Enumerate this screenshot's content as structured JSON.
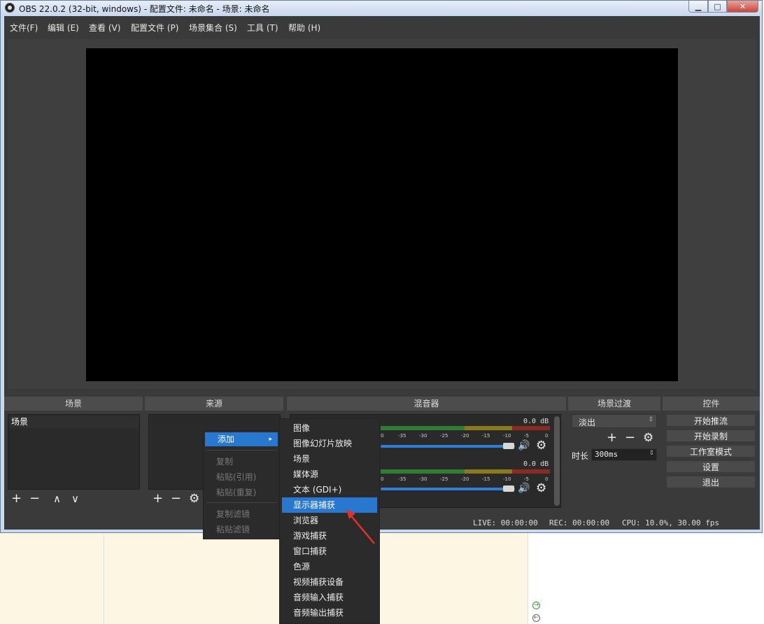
{
  "window": {
    "title": "OBS 22.0.2 (32-bit, windows) - 配置文件: 未命名 - 场景: 未命名",
    "minimize_glyph": "▁",
    "maximize_glyph": "□",
    "close_glyph": "✕"
  },
  "menubar": [
    "文件(F)",
    "编辑 (E)",
    "查看 (V)",
    "配置文件 (P)",
    "场景集合 (S)",
    "工具 (T)",
    "帮助 (H)"
  ],
  "docks": {
    "scenes": "场景",
    "sources": "来源",
    "mixer": "混音器",
    "transitions": "场景过渡",
    "controls": "控件"
  },
  "scenes": {
    "items": [
      "场景"
    ],
    "add_icon": "+",
    "remove_icon": "−",
    "up_icon": "∧",
    "down_icon": "∨"
  },
  "sources": {
    "add_icon": "+",
    "remove_icon": "−",
    "settings_icon": "⚙"
  },
  "mixer": {
    "tracks": [
      {
        "db": "0.0 dB"
      },
      {
        "db": "0.0 dB"
      }
    ],
    "ticks": [
      "0",
      "-35",
      "-30",
      "-25",
      "-20",
      "-15",
      "-10",
      "-5",
      "0"
    ],
    "speaker_icon": "🔊",
    "settings_icon": "⚙"
  },
  "transitions": {
    "selected": "淡出",
    "duration_label": "时长",
    "duration_value": "300ms",
    "add_icon": "+",
    "remove_icon": "−",
    "settings_icon": "⚙"
  },
  "controls": [
    "开始推流",
    "开始录制",
    "工作室模式",
    "设置",
    "退出"
  ],
  "status": {
    "live": "LIVE: 00:00:00",
    "rec": "REC: 00:00:00",
    "cpu": "CPU: 10.0%, 30.00 fps"
  },
  "context_menu": {
    "add": "添加",
    "arrow": "▸",
    "items": [
      "复制",
      "粘贴(引用)",
      "粘贴(重复)",
      "复制滤镜",
      "粘贴滤镜"
    ]
  },
  "add_submenu": {
    "items": [
      "图像",
      "图像幻灯片放映",
      "场景",
      "媒体源",
      "文本 (GDI+)",
      "显示器捕获",
      "浏览器",
      "游戏捕获",
      "窗口捕获",
      "色源",
      "视频捕获设备",
      "音频输入捕获",
      "音频输出捕获"
    ],
    "selected_index": 5
  },
  "colors": {
    "accent": "#2878d0",
    "annotation_arrow": "#e0322a"
  }
}
